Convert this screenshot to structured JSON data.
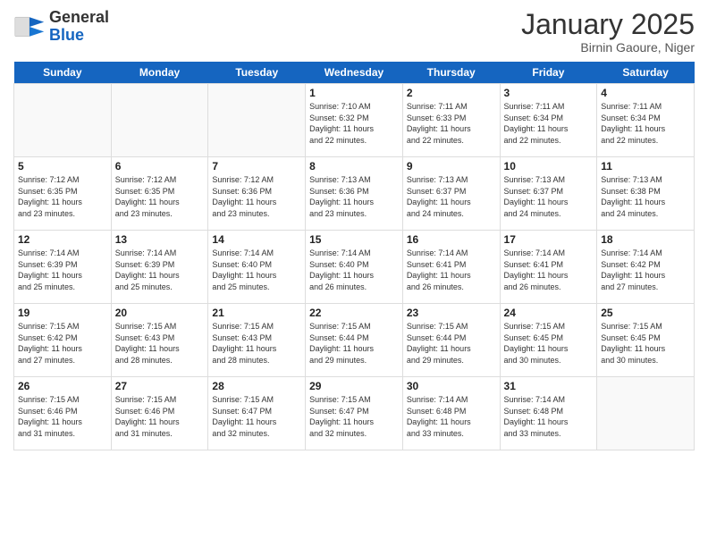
{
  "header": {
    "logo_general": "General",
    "logo_blue": "Blue",
    "month_title": "January 2025",
    "location": "Birnin Gaoure, Niger"
  },
  "days_of_week": [
    "Sunday",
    "Monday",
    "Tuesday",
    "Wednesday",
    "Thursday",
    "Friday",
    "Saturday"
  ],
  "weeks": [
    [
      {
        "day": "",
        "info": ""
      },
      {
        "day": "",
        "info": ""
      },
      {
        "day": "",
        "info": ""
      },
      {
        "day": "1",
        "info": "Sunrise: 7:10 AM\nSunset: 6:32 PM\nDaylight: 11 hours and 22 minutes."
      },
      {
        "day": "2",
        "info": "Sunrise: 7:11 AM\nSunset: 6:33 PM\nDaylight: 11 hours and 22 minutes."
      },
      {
        "day": "3",
        "info": "Sunrise: 7:11 AM\nSunset: 6:34 PM\nDaylight: 11 hours and 22 minutes."
      },
      {
        "day": "4",
        "info": "Sunrise: 7:11 AM\nSunset: 6:34 PM\nDaylight: 11 hours and 22 minutes."
      }
    ],
    [
      {
        "day": "5",
        "info": "Sunrise: 7:12 AM\nSunset: 6:35 PM\nDaylight: 11 hours and 23 minutes."
      },
      {
        "day": "6",
        "info": "Sunrise: 7:12 AM\nSunset: 6:35 PM\nDaylight: 11 hours and 23 minutes."
      },
      {
        "day": "7",
        "info": "Sunrise: 7:12 AM\nSunset: 6:36 PM\nDaylight: 11 hours and 23 minutes."
      },
      {
        "day": "8",
        "info": "Sunrise: 7:13 AM\nSunset: 6:36 PM\nDaylight: 11 hours and 23 minutes."
      },
      {
        "day": "9",
        "info": "Sunrise: 7:13 AM\nSunset: 6:37 PM\nDaylight: 11 hours and 24 minutes."
      },
      {
        "day": "10",
        "info": "Sunrise: 7:13 AM\nSunset: 6:37 PM\nDaylight: 11 hours and 24 minutes."
      },
      {
        "day": "11",
        "info": "Sunrise: 7:13 AM\nSunset: 6:38 PM\nDaylight: 11 hours and 24 minutes."
      }
    ],
    [
      {
        "day": "12",
        "info": "Sunrise: 7:14 AM\nSunset: 6:39 PM\nDaylight: 11 hours and 25 minutes."
      },
      {
        "day": "13",
        "info": "Sunrise: 7:14 AM\nSunset: 6:39 PM\nDaylight: 11 hours and 25 minutes."
      },
      {
        "day": "14",
        "info": "Sunrise: 7:14 AM\nSunset: 6:40 PM\nDaylight: 11 hours and 25 minutes."
      },
      {
        "day": "15",
        "info": "Sunrise: 7:14 AM\nSunset: 6:40 PM\nDaylight: 11 hours and 26 minutes."
      },
      {
        "day": "16",
        "info": "Sunrise: 7:14 AM\nSunset: 6:41 PM\nDaylight: 11 hours and 26 minutes."
      },
      {
        "day": "17",
        "info": "Sunrise: 7:14 AM\nSunset: 6:41 PM\nDaylight: 11 hours and 26 minutes."
      },
      {
        "day": "18",
        "info": "Sunrise: 7:14 AM\nSunset: 6:42 PM\nDaylight: 11 hours and 27 minutes."
      }
    ],
    [
      {
        "day": "19",
        "info": "Sunrise: 7:15 AM\nSunset: 6:42 PM\nDaylight: 11 hours and 27 minutes."
      },
      {
        "day": "20",
        "info": "Sunrise: 7:15 AM\nSunset: 6:43 PM\nDaylight: 11 hours and 28 minutes."
      },
      {
        "day": "21",
        "info": "Sunrise: 7:15 AM\nSunset: 6:43 PM\nDaylight: 11 hours and 28 minutes."
      },
      {
        "day": "22",
        "info": "Sunrise: 7:15 AM\nSunset: 6:44 PM\nDaylight: 11 hours and 29 minutes."
      },
      {
        "day": "23",
        "info": "Sunrise: 7:15 AM\nSunset: 6:44 PM\nDaylight: 11 hours and 29 minutes."
      },
      {
        "day": "24",
        "info": "Sunrise: 7:15 AM\nSunset: 6:45 PM\nDaylight: 11 hours and 30 minutes."
      },
      {
        "day": "25",
        "info": "Sunrise: 7:15 AM\nSunset: 6:45 PM\nDaylight: 11 hours and 30 minutes."
      }
    ],
    [
      {
        "day": "26",
        "info": "Sunrise: 7:15 AM\nSunset: 6:46 PM\nDaylight: 11 hours and 31 minutes."
      },
      {
        "day": "27",
        "info": "Sunrise: 7:15 AM\nSunset: 6:46 PM\nDaylight: 11 hours and 31 minutes."
      },
      {
        "day": "28",
        "info": "Sunrise: 7:15 AM\nSunset: 6:47 PM\nDaylight: 11 hours and 32 minutes."
      },
      {
        "day": "29",
        "info": "Sunrise: 7:15 AM\nSunset: 6:47 PM\nDaylight: 11 hours and 32 minutes."
      },
      {
        "day": "30",
        "info": "Sunrise: 7:14 AM\nSunset: 6:48 PM\nDaylight: 11 hours and 33 minutes."
      },
      {
        "day": "31",
        "info": "Sunrise: 7:14 AM\nSunset: 6:48 PM\nDaylight: 11 hours and 33 minutes."
      },
      {
        "day": "",
        "info": ""
      }
    ]
  ]
}
